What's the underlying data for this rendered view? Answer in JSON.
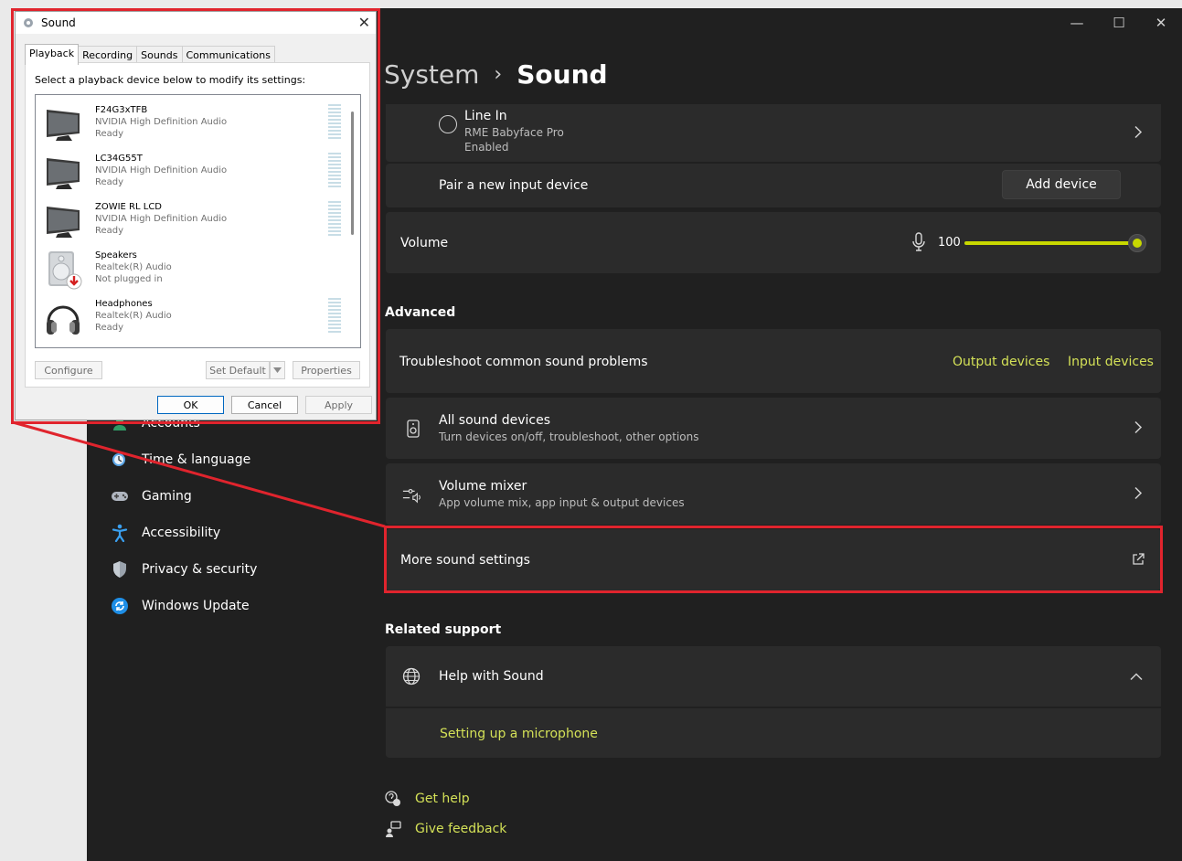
{
  "window": {
    "caption": {
      "minimize": "—",
      "maximize": "☐",
      "close": "✕"
    }
  },
  "breadcrumb": {
    "parent": "System",
    "separator": "›",
    "current": "Sound"
  },
  "input_device": {
    "name": "Line In",
    "device": "RME Babyface Pro",
    "status": "Enabled"
  },
  "pair": {
    "label": "Pair a new input device",
    "button": "Add device"
  },
  "volume": {
    "label": "Volume",
    "value": "100",
    "level": 1.0
  },
  "advanced": {
    "heading": "Advanced",
    "troubleshoot": {
      "label": "Troubleshoot common sound problems",
      "output_link": "Output devices",
      "input_link": "Input devices"
    },
    "all_devices": {
      "title": "All sound devices",
      "subtitle": "Turn devices on/off, troubleshoot, other options"
    },
    "mixer": {
      "title": "Volume mixer",
      "subtitle": "App volume mix, app input & output devices"
    },
    "more": {
      "label": "More sound settings"
    }
  },
  "related": {
    "heading": "Related support",
    "help": {
      "title": "Help with Sound",
      "link": "Setting up a microphone"
    }
  },
  "footer": {
    "get_help": "Get help",
    "feedback": "Give feedback"
  },
  "sidebar": {
    "items": [
      {
        "label": "Accounts"
      },
      {
        "label": "Time & language"
      },
      {
        "label": "Gaming"
      },
      {
        "label": "Accessibility"
      },
      {
        "label": "Privacy & security"
      },
      {
        "label": "Windows Update"
      }
    ]
  },
  "dialog": {
    "title": "Sound",
    "close": "✕",
    "tabs": [
      "Playback",
      "Recording",
      "Sounds",
      "Communications"
    ],
    "instruction": "Select a playback device below to modify its settings:",
    "devices": [
      {
        "name": "F24G3xTFB",
        "driver": "NVIDIA High Definition Audio",
        "status": "Ready",
        "icon": "monitor"
      },
      {
        "name": "LC34G55T",
        "driver": "NVIDIA High Definition Audio",
        "status": "Ready",
        "icon": "monitor"
      },
      {
        "name": "ZOWIE RL LCD",
        "driver": "NVIDIA High Definition Audio",
        "status": "Ready",
        "icon": "monitor"
      },
      {
        "name": "Speakers",
        "driver": "Realtek(R) Audio",
        "status": "Not plugged in",
        "icon": "speaker"
      },
      {
        "name": "Headphones",
        "driver": "Realtek(R) Audio",
        "status": "Ready",
        "icon": "headphones"
      }
    ],
    "buttons": {
      "configure": "Configure",
      "set_default": "Set Default",
      "properties": "Properties",
      "ok": "OK",
      "cancel": "Cancel",
      "apply": "Apply"
    }
  },
  "colors": {
    "accent": "#c8d800",
    "highlight": "#e0242d",
    "background": "#202020",
    "card": "#2b2b2b"
  }
}
